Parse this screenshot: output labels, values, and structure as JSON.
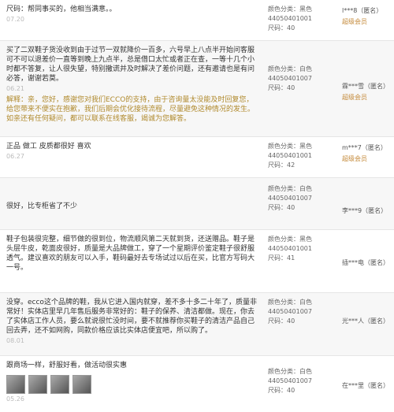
{
  "reviews": [
    {
      "text": "尺码：帮同事买的，他相当满意。。",
      "date": "07.20",
      "color": "颜色分类：黑色",
      "code": "44050401001",
      "size": "尺码：40",
      "user": "l***8（匿名）",
      "level": "超级会员"
    },
    {
      "text": "买了二双鞋子货没收到由于过节一双就降价一百多，六号早上八点半开始问客服可不可以退差价一直等到晚上九点半，总是借口太忙或者正在查，一等十几个小时都不答复，让人很失望，特别撒谎并及时解决了差价问题，还有邀请也是有问必答，谢谢若莫。",
      "date": "06.21",
      "reply": "解释：亲，您好，感谢您对我们ECCO的支持，由于咨询量太没能及时回复您，给您带来不便实在抱歉，我们后期会优化接待流程，尽量避免这种情况的发生。如亲还有任何疑问，都可以联系在线客服，竭诚为您解答。",
      "color": "颜色分类：白色",
      "code": "44050401007",
      "size": "尺码：40",
      "user": "霖***雪（匿名）",
      "level": "超级会员"
    },
    {
      "text": "正品 做工 皮质都很好 喜欢",
      "date": "06.27",
      "color": "颜色分类：黑色",
      "code": "44050401001",
      "size": "尺码：42",
      "user": "m***7（匿名）",
      "level": "超级会员"
    },
    {
      "text": "很好，比专柜省了不少",
      "date": "",
      "color": "颜色分类：白色",
      "code": "44050401007",
      "size": "尺码：40",
      "user": "李***9（匿名）",
      "level": ""
    },
    {
      "text": "鞋子包装很完整，细节做的很到位，物流顺风第二天就到货，还送赠品。鞋子是头层牛皮，乾面皮很好，质量是大品牌做工，穿了一个星期评价鉴定鞋子很舒服透气。建议喜欢的朋友可以入手，鞋码最好去专场试过以后在买，比官方写码大一号。",
      "date": "",
      "color": "颜色分类：黑色",
      "code": "44050401001",
      "size": "尺码：41",
      "user": "插***电（匿名）",
      "level": ""
    },
    {
      "text": "没穿。ecco这个品牌的鞋，我从它进入国内就穿，差不多十多二十年了，质量非常好！实体店里早几年售后服务非常好的：鞋子的保养、清洁都做。现在，你去了实体店工作人员，要么就说很忙没时间，要不就推荐你买鞋子的清洁产品自己回去弄，还不如网购，同款价格应该比实体店便宜吧，所以购了。",
      "date": "08.01",
      "color": "颜色分类：白色",
      "code": "44050401007",
      "size": "尺码：40",
      "user": "光***人（匿名）",
      "level": ""
    },
    {
      "text": "跟商场一样，舒服好看，做活动很实惠",
      "date": "05.26",
      "color": "颜色分类：白色",
      "code": "44050401007",
      "size": "尺码：40",
      "user": "在***里（匿名）",
      "level": ""
    }
  ]
}
